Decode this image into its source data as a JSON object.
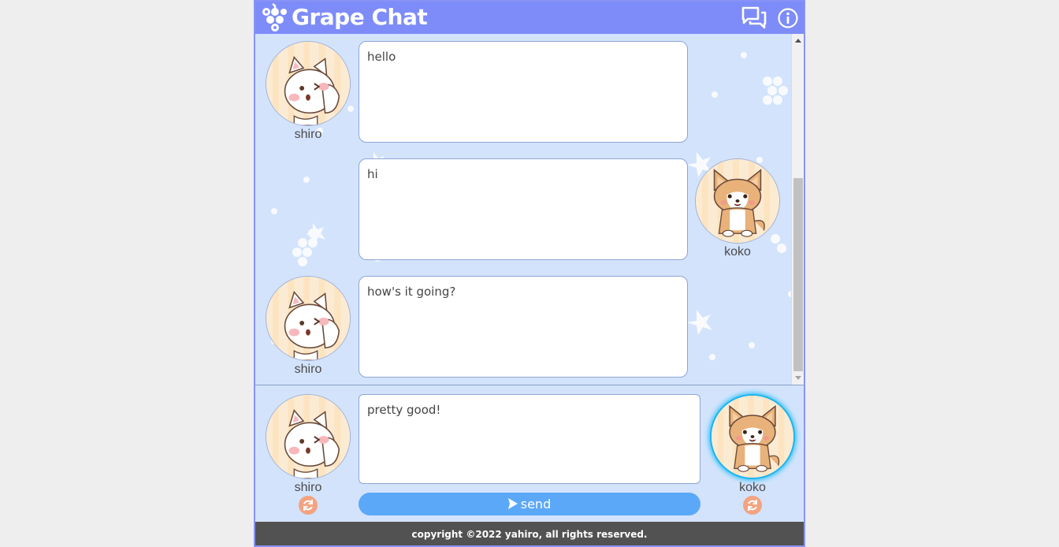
{
  "app": {
    "title": "Grape Chat",
    "icons": {
      "logo": "grape-logo-icon",
      "chat": "chat-bubbles-icon",
      "info": "info-icon"
    },
    "colors": {
      "header": "#7d8cf8",
      "background": "#d3e3fc",
      "send_button": "#5ba8f9",
      "switch_button": "#f4a380",
      "active_ring": "#19b4f0",
      "footer": "#525252"
    }
  },
  "messages": [
    {
      "user": "shiro",
      "side": "left",
      "text": "hello",
      "avatar": "cat-avatar"
    },
    {
      "user": "koko",
      "side": "right",
      "text": "hi",
      "avatar": "dog-avatar"
    },
    {
      "user": "shiro",
      "side": "left",
      "text": "how's it going?",
      "avatar": "cat-avatar"
    }
  ],
  "composer": {
    "left_user": "shiro",
    "right_user": "koko",
    "active_user": "koko",
    "input_value": "pretty good!",
    "send_label": "send",
    "send_icon": "paper-plane-icon",
    "switch_icon": "refresh-icon"
  },
  "footer": {
    "text": "copyright ©2022 yahiro, all rights reserved."
  }
}
